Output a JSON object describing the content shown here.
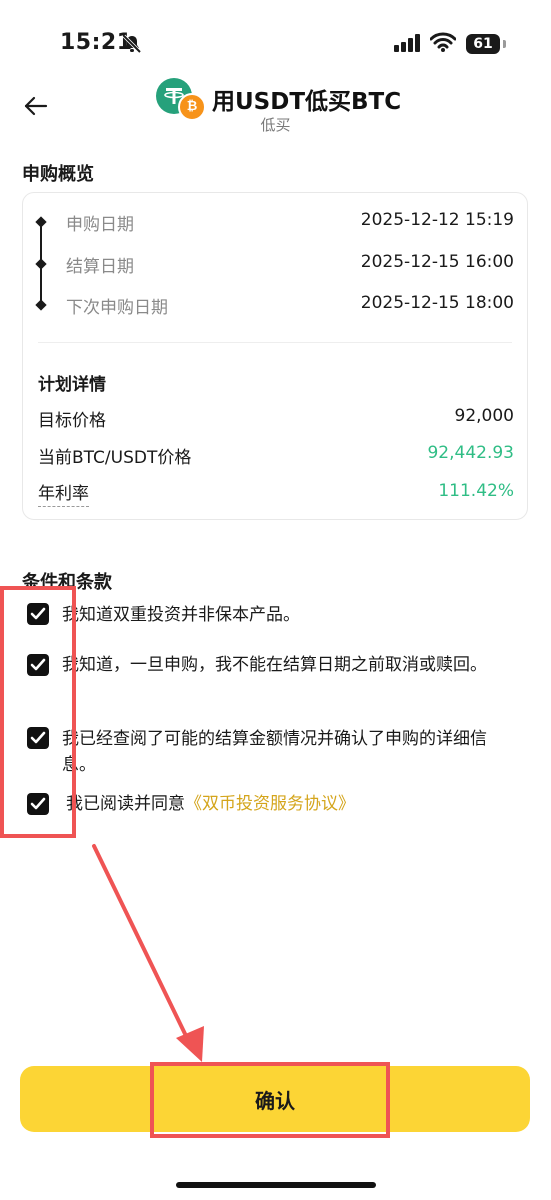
{
  "status_bar": {
    "time": "15:21",
    "battery": "61"
  },
  "header": {
    "title": "用USDT低买BTC",
    "subtitle": "低买",
    "coin_usdt": "₮",
    "coin_btc": "₿"
  },
  "overview": {
    "title": "申购概览",
    "timeline": [
      {
        "label": "申购日期",
        "value": "2025-12-12 15:19"
      },
      {
        "label": "结算日期",
        "value": "2025-12-15 16:00"
      },
      {
        "label": "下次申购日期",
        "value": "2025-12-15 18:00"
      }
    ],
    "plan_title": "计划详情",
    "plan": [
      {
        "label": "目标价格",
        "value": "92,000"
      },
      {
        "label": "当前BTC/USDT价格",
        "value": "92,442.93"
      },
      {
        "label": "年利率",
        "value": "111.42%"
      }
    ]
  },
  "terms": {
    "title": "条件和条款",
    "items": [
      {
        "text": "我知道双重投资并非保本产品。",
        "checked": true
      },
      {
        "text": "我知道，一旦申购，我不能在结算日期之前取消或赎回。",
        "checked": true
      },
      {
        "text": "我已经查阅了可能的结算金额情况并确认了申购的详细信息。",
        "checked": true
      },
      {
        "text": "我已阅读并同意",
        "link": "《双币投资服务协议》",
        "checked": true
      }
    ]
  },
  "confirm_label": "确认",
  "colors": {
    "accent": "#fcd535",
    "positive": "#2fbd85",
    "link": "#d4a51c",
    "annotation": "#ef5454"
  }
}
